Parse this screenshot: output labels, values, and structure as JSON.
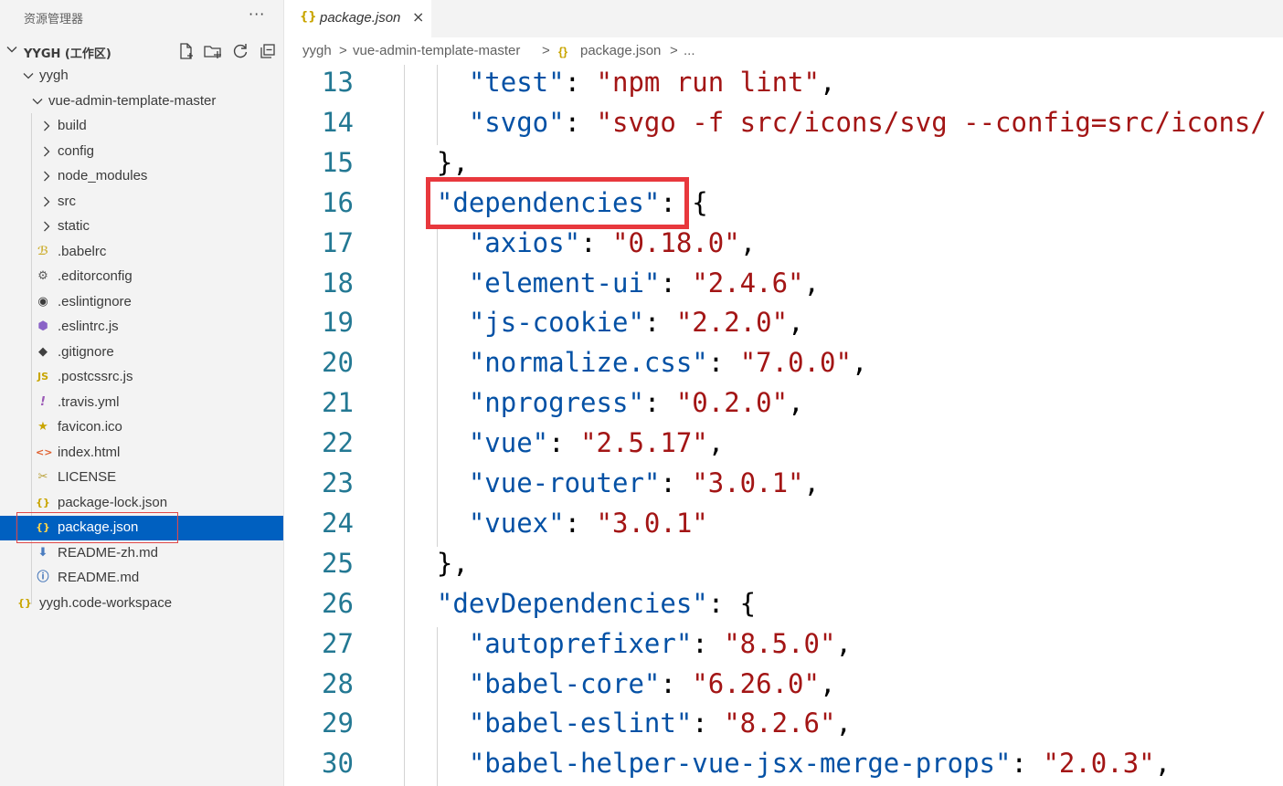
{
  "sidebar": {
    "title": "资源管理器",
    "more": "···",
    "workspace": "YYGH (工作区)",
    "tree": [
      {
        "label": "yygh",
        "kind": "folder-open",
        "depth": 1
      },
      {
        "label": "vue-admin-template-master",
        "kind": "folder-open",
        "depth": 2
      },
      {
        "label": "build",
        "kind": "folder",
        "depth": 3
      },
      {
        "label": "config",
        "kind": "folder",
        "depth": 3
      },
      {
        "label": "node_modules",
        "kind": "folder",
        "depth": 3
      },
      {
        "label": "src",
        "kind": "folder",
        "depth": 3
      },
      {
        "label": "static",
        "kind": "folder",
        "depth": 3
      },
      {
        "label": ".babelrc",
        "kind": "babel",
        "depth": 3
      },
      {
        "label": ".editorconfig",
        "kind": "gear",
        "depth": 3
      },
      {
        "label": ".eslintignore",
        "kind": "eslint-ignore",
        "depth": 3
      },
      {
        "label": ".eslintrc.js",
        "kind": "eslint",
        "depth": 3
      },
      {
        "label": ".gitignore",
        "kind": "git",
        "depth": 3
      },
      {
        "label": ".postcssrc.js",
        "kind": "js",
        "depth": 3
      },
      {
        "label": ".travis.yml",
        "kind": "yaml",
        "depth": 3
      },
      {
        "label": "favicon.ico",
        "kind": "star",
        "depth": 3
      },
      {
        "label": "index.html",
        "kind": "html",
        "depth": 3
      },
      {
        "label": "LICENSE",
        "kind": "license",
        "depth": 3
      },
      {
        "label": "package-lock.json",
        "kind": "json",
        "depth": 3
      },
      {
        "label": "package.json",
        "kind": "json",
        "depth": 3,
        "selected": true
      },
      {
        "label": "README-zh.md",
        "kind": "markdown",
        "depth": 3
      },
      {
        "label": "README.md",
        "kind": "info",
        "depth": 3
      },
      {
        "label": "yygh.code-workspace",
        "kind": "json",
        "depth": 1
      }
    ]
  },
  "tab": {
    "icon": "{}",
    "label": "package.json",
    "close": "×"
  },
  "breadcrumb": [
    "yygh",
    ">",
    "vue-admin-template-master",
    ">",
    "{}",
    "package.json",
    ">",
    "..."
  ],
  "editor": {
    "lines": [
      {
        "n": "13",
        "code": "    \"test\": \"npm run lint\","
      },
      {
        "n": "14",
        "code": "    \"svgo\": \"svgo -f src/icons/svg --config=src/icons/"
      },
      {
        "n": "15",
        "code": "  },"
      },
      {
        "n": "16",
        "code": "  \"dependencies\": {"
      },
      {
        "n": "17",
        "code": "    \"axios\": \"0.18.0\","
      },
      {
        "n": "18",
        "code": "    \"element-ui\": \"2.4.6\","
      },
      {
        "n": "19",
        "code": "    \"js-cookie\": \"2.2.0\","
      },
      {
        "n": "20",
        "code": "    \"normalize.css\": \"7.0.0\","
      },
      {
        "n": "21",
        "code": "    \"nprogress\": \"0.2.0\","
      },
      {
        "n": "22",
        "code": "    \"vue\": \"2.5.17\","
      },
      {
        "n": "23",
        "code": "    \"vue-router\": \"3.0.1\","
      },
      {
        "n": "24",
        "code": "    \"vuex\": \"3.0.1\""
      },
      {
        "n": "25",
        "code": "  },"
      },
      {
        "n": "26",
        "code": "  \"devDependencies\": {"
      },
      {
        "n": "27",
        "code": "    \"autoprefixer\": \"8.5.0\","
      },
      {
        "n": "28",
        "code": "    \"babel-core\": \"6.26.0\","
      },
      {
        "n": "29",
        "code": "    \"babel-eslint\": \"8.2.6\","
      },
      {
        "n": "30",
        "code": "    \"babel-helper-vue-jsx-merge-props\": \"2.0.3\","
      }
    ]
  },
  "colors": {
    "json_key": "#0451a5",
    "json_string": "#a31515",
    "line_number": "#237893",
    "selection": "#0060c0",
    "highlight_box": "#e8383d"
  }
}
